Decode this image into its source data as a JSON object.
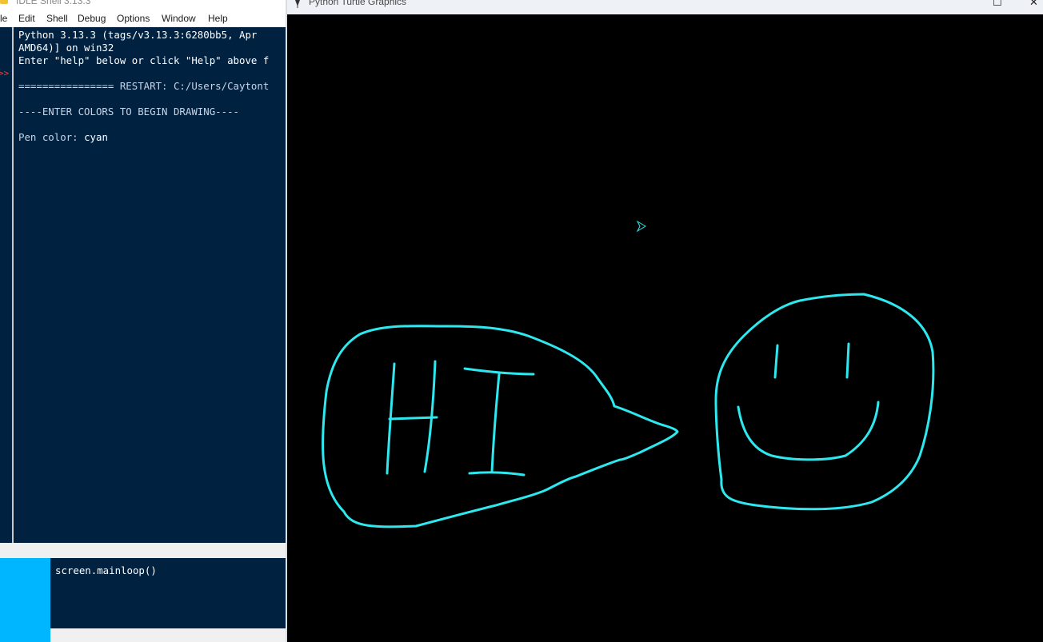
{
  "idle": {
    "title": "IDLE Shell 3.13.3",
    "menu": [
      "le",
      "Edit",
      "Shell",
      "Debug",
      "Options",
      "Window",
      "Help"
    ],
    "shell_lines": [
      "Python 3.13.3 (tags/v3.13.3:6280bb5, Apr",
      "AMD64)] on win32",
      "Enter \"help\" below or click \"Help\" above f",
      "",
      "================ RESTART: C:/Users/Caytont",
      "",
      "----ENTER COLORS TO BEGIN DRAWING----",
      ""
    ],
    "prompt_label": "Pen color: ",
    "prompt_value": "cyan",
    "prompt_marker": ">>",
    "editor_code": "screen.mainloop()"
  },
  "turtle": {
    "title": "Python Turtle Graphics",
    "background": "#000000",
    "pen_color": "#2ee8f0",
    "cursor_color": "#2ee8f0",
    "drawing_text": "HI"
  },
  "colors": {
    "shell_bg": "#002240",
    "gutter_accent": "#00b7ff"
  }
}
